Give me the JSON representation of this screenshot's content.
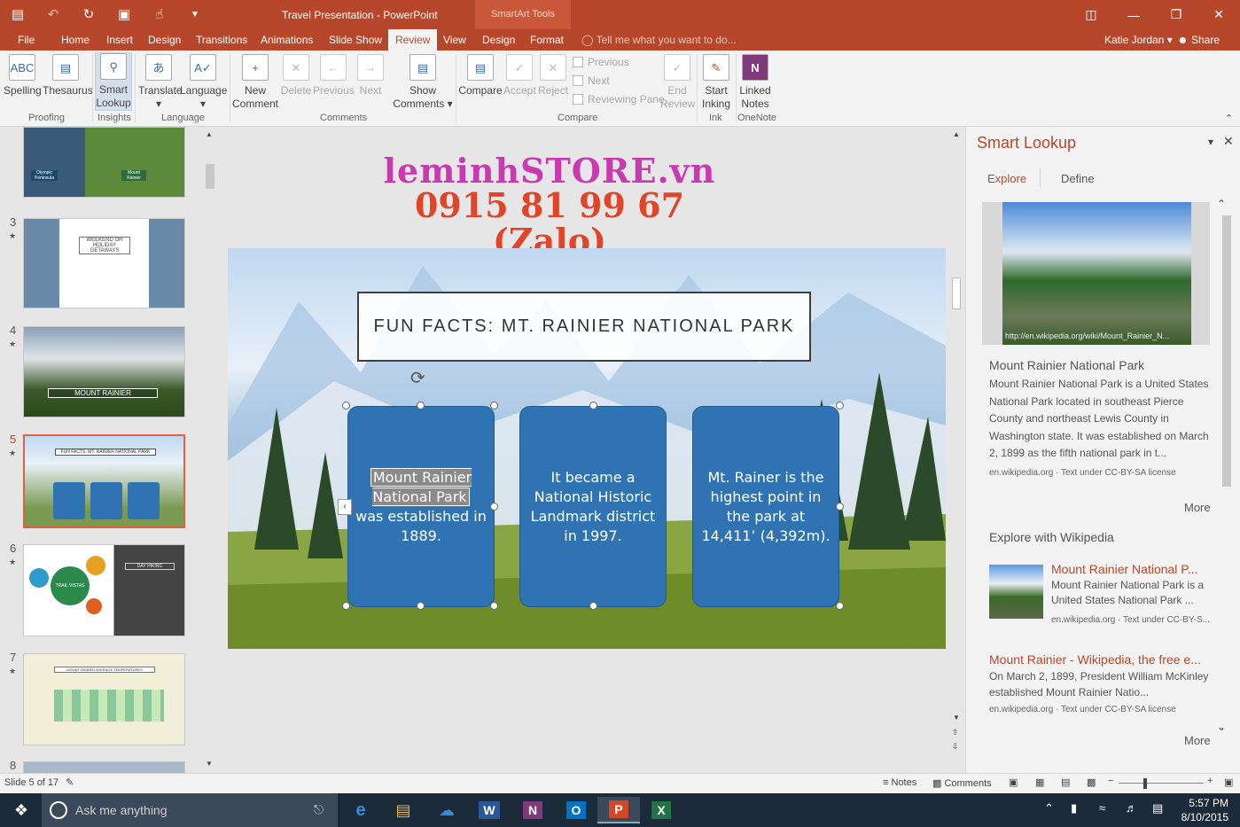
{
  "titlebar": {
    "doc_title": "Travel Presentation - PowerPoint",
    "context_tools": "SmartArt Tools"
  },
  "tabs": [
    "File",
    "Home",
    "Insert",
    "Design",
    "Transitions",
    "Animations",
    "Slide Show",
    "Review",
    "View",
    "Design",
    "Format"
  ],
  "active_tab": "Review",
  "tell_me": "Tell me what you want to do...",
  "user": "Katie Jordan",
  "share": "Share",
  "ribbon": {
    "spelling": "Spelling",
    "thesaurus": "Thesaurus",
    "smart1": "Smart",
    "smart2": "Lookup",
    "translate": "Translate",
    "language": "Language",
    "new1": "New",
    "new2": "Comment",
    "delete": "Delete",
    "previous": "Previous",
    "next": "Next",
    "show1": "Show",
    "show2": "Comments",
    "compare": "Compare",
    "accept": "Accept",
    "reject": "Reject",
    "prev_small": "Previous",
    "next_small": "Next",
    "reviewing_pane": "Reviewing Pane",
    "end1": "End",
    "end2": "Review",
    "start1": "Start",
    "start2": "Inking",
    "linked1": "Linked",
    "linked2": "Notes",
    "groups": {
      "proofing": "Proofing",
      "insights": "Insights",
      "language": "Language",
      "comments": "Comments",
      "compare": "Compare",
      "ink": "Ink",
      "onenote": "OneNote"
    }
  },
  "thumbs": [
    {
      "num": "3",
      "text": "WEEKEND OR HOLIDAY GETAWAYS"
    },
    {
      "num": "4",
      "text": "MOUNT RAINIER"
    },
    {
      "num": "5",
      "text": "FUN FACTS: MT. RAINIER NATIONAL PARK"
    },
    {
      "num": "6",
      "text": "DAY HIKING"
    },
    {
      "num": "7",
      "text": "MOUNT RAINIER AVERAGE TEMPERATURES"
    },
    {
      "num": "8",
      "text": ""
    }
  ],
  "thumb2_labels": {
    "a": "Olympic Peninsula",
    "b": "Mount Rainier"
  },
  "thumb6_labels": {
    "trail": "TRAIL VISTAS"
  },
  "watermark": {
    "line1": "leminhSTORE.vn",
    "line2": "0915 81 99 67 (Zalo)"
  },
  "slide": {
    "title": "FUN FACTS: MT. RAINIER NATIONAL PARK",
    "card1_hl": "Mount Rainier National Park",
    "card1_rest": "was  established in 1889.",
    "card2": "It became a National Historic Landmark district in 1997.",
    "card3": "Mt. Rainer is the highest point in the park at 14,411’ (4,392m)."
  },
  "pane": {
    "title": "Smart Lookup",
    "tab_explore": "Explore",
    "tab_define": "Define",
    "img_caption": "http://en.wikipedia.org/wiki/Mount_Rainier_N...",
    "r1_title": "Mount Rainier National Park",
    "r1_text": "Mount Rainier National Park is a United States National Park located in southeast Pierce County and northeast Lewis County in Washington state. It was established on March 2, 1899 as the fifth national park in t...",
    "r1_src": "en.wikipedia.org · Text under CC-BY-SA license",
    "more": "More",
    "explore_head": "Explore with Wikipedia",
    "r2_title": "Mount Rainier National P...",
    "r2_text": "Mount Rainier National Park is a United States National Park ...",
    "r2_src": "en.wikipedia.org · Text under CC-BY-S...",
    "r3_title": "Mount Rainier - Wikipedia, the free e...",
    "r3_text": "On March 2, 1899, President William McKinley established Mount Rainier Natio...",
    "r3_src": "en.wikipedia.org · Text under CC-BY-SA license"
  },
  "status": {
    "slide": "Slide 5 of 17",
    "notes": "Notes",
    "comments": "Comments"
  },
  "taskbar": {
    "ask": "Ask me anything",
    "time": "5:57 PM",
    "date": "8/10/2015"
  }
}
